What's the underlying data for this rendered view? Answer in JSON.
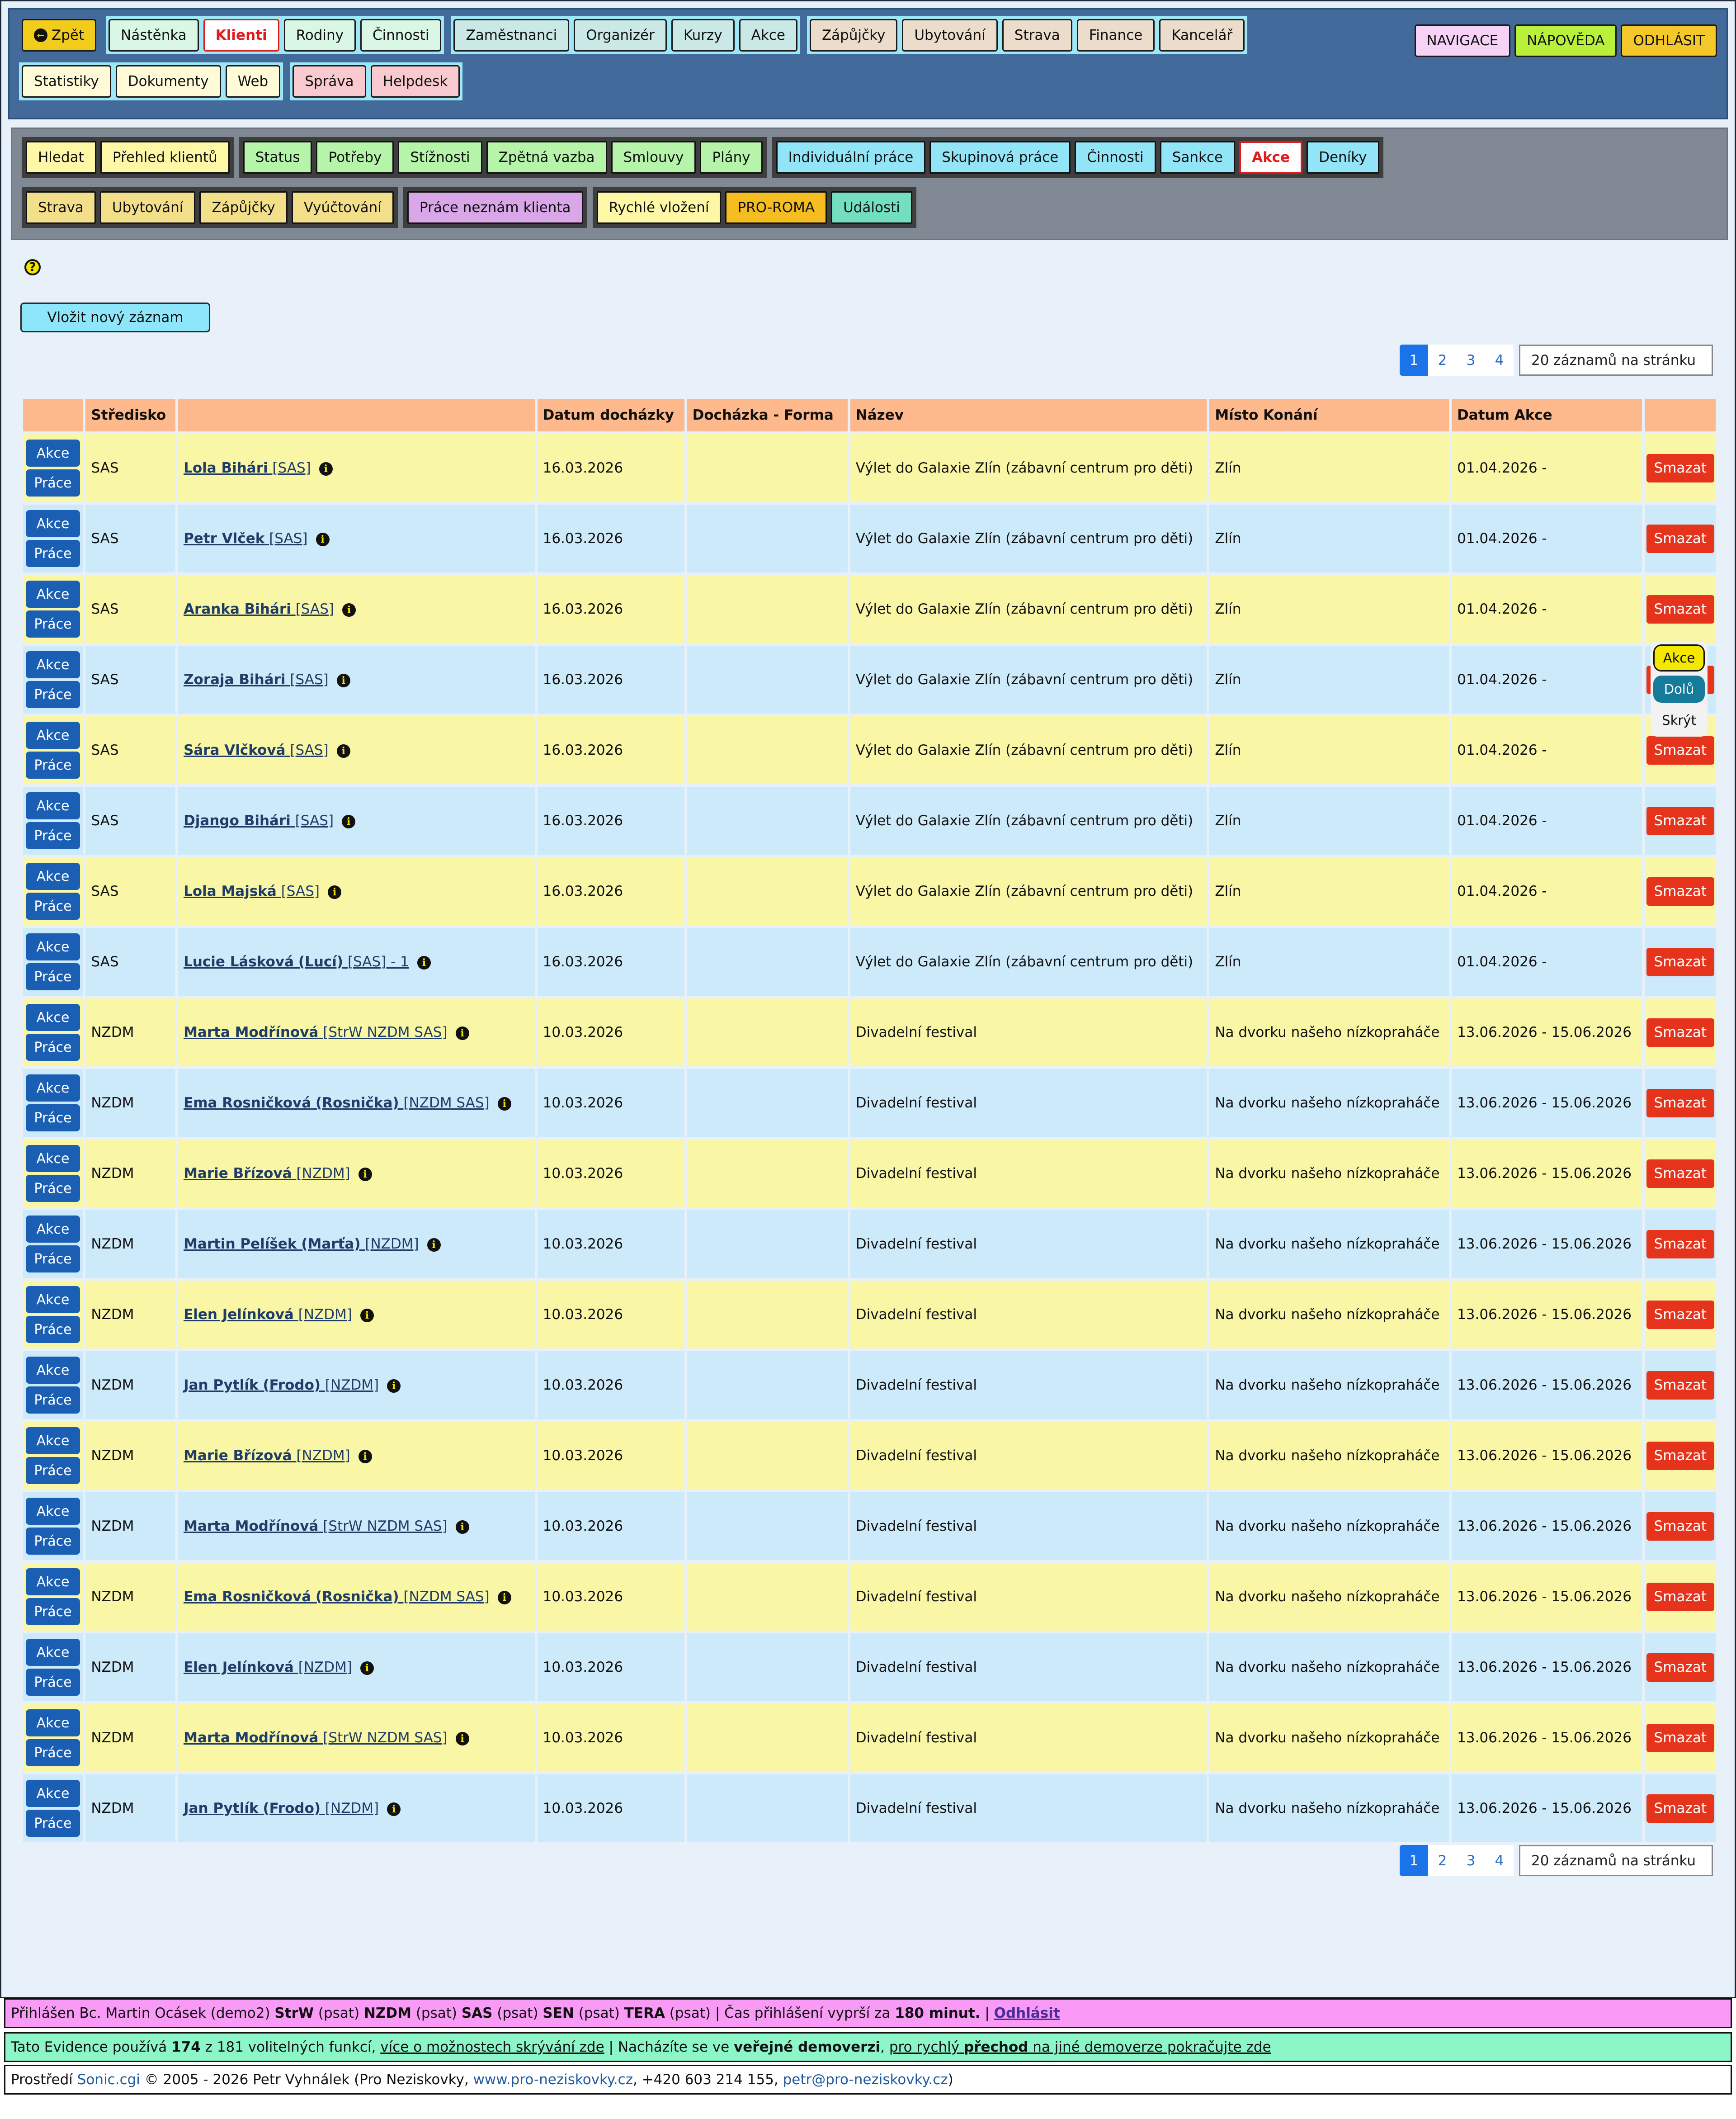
{
  "topnav": {
    "row1": [
      {
        "label": "Zpět",
        "style": "c-yellow",
        "icon": "back-arrow-icon",
        "group": 0
      },
      {
        "label": "Nástěnka",
        "style": "c-mint",
        "group": 1
      },
      {
        "label": "Klienti",
        "style": "c-active",
        "group": 1
      },
      {
        "label": "Rodiny",
        "style": "c-mint",
        "group": 1
      },
      {
        "label": "Činnosti",
        "style": "c-mint",
        "group": 1
      },
      {
        "label": "Zaměstnanci",
        "style": "c-teal",
        "group": 2
      },
      {
        "label": "Organizér",
        "style": "c-teal",
        "group": 2
      },
      {
        "label": "Kurzy",
        "style": "c-teal",
        "group": 2
      },
      {
        "label": "Akce",
        "style": "c-teal",
        "group": 2
      },
      {
        "label": "Zápůjčky",
        "style": "c-beige",
        "group": 3
      },
      {
        "label": "Ubytování",
        "style": "c-beige",
        "group": 3
      },
      {
        "label": "Strava",
        "style": "c-beige",
        "group": 3
      },
      {
        "label": "Finance",
        "style": "c-beige",
        "group": 3
      },
      {
        "label": "Kancelář",
        "style": "c-beige",
        "group": 3
      }
    ],
    "row2": [
      {
        "label": "Statistiky",
        "style": "c-cream",
        "group": 4
      },
      {
        "label": "Dokumenty",
        "style": "c-cream",
        "group": 4
      },
      {
        "label": "Web",
        "style": "c-cream",
        "group": 4
      },
      {
        "label": "Správa",
        "style": "c-pink",
        "group": 5
      },
      {
        "label": "Helpdesk",
        "style": "c-pink",
        "group": 5
      }
    ],
    "right": [
      {
        "label": "NAVIGACE",
        "style": "c-lavender"
      },
      {
        "label": "NÁPOVĚDA",
        "style": "c-lime"
      },
      {
        "label": "ODHLÁSIT",
        "style": "c-gold"
      }
    ]
  },
  "subnav": {
    "row1": [
      [
        {
          "label": "Hledat",
          "style": "s-yel"
        },
        {
          "label": "Přehled klientů",
          "style": "s-yel"
        }
      ],
      [
        {
          "label": "Status",
          "style": "s-green"
        },
        {
          "label": "Potřeby",
          "style": "s-green"
        },
        {
          "label": "Stížnosti",
          "style": "s-green"
        },
        {
          "label": "Zpětná vazba",
          "style": "s-green"
        },
        {
          "label": "Smlouvy",
          "style": "s-green"
        },
        {
          "label": "Plány",
          "style": "s-green"
        }
      ],
      [
        {
          "label": "Individuální práce",
          "style": "s-cyan"
        },
        {
          "label": "Skupinová práce",
          "style": "s-cyan"
        },
        {
          "label": "Činnosti",
          "style": "s-cyan"
        },
        {
          "label": "Sankce",
          "style": "s-cyan"
        },
        {
          "label": "Akce",
          "style": "s-active"
        },
        {
          "label": "Deníky",
          "style": "s-cyan"
        }
      ]
    ],
    "row2": [
      [
        {
          "label": "Strava",
          "style": "s-sand"
        },
        {
          "label": "Ubytování",
          "style": "s-sand"
        },
        {
          "label": "Zápůjčky",
          "style": "s-sand"
        },
        {
          "label": "Vyúčtování",
          "style": "s-sand"
        }
      ],
      [
        {
          "label": "Práce neznám klienta",
          "style": "s-violet"
        }
      ],
      [
        {
          "label": "Rychlé vložení",
          "style": "s-yel"
        },
        {
          "label": "PRO-ROMA",
          "style": "s-orange"
        },
        {
          "label": "Události",
          "style": "s-sea"
        }
      ]
    ]
  },
  "content": {
    "help_glyph": "?",
    "new_record_label": "Vložit nový záznam",
    "pager": {
      "pages": [
        "1",
        "2",
        "3",
        "4"
      ],
      "current": "1",
      "page_size": "20 záznamů na stránku"
    }
  },
  "table": {
    "headers": [
      "",
      "Středisko",
      "",
      "Datum docházky",
      "Docházka - Forma",
      "Název",
      "Místo Konání",
      "Datum Akce",
      ""
    ],
    "row_buttons": {
      "akce": "Akce",
      "prace": "Práce",
      "delete": "Smazat"
    },
    "rows": [
      {
        "stredisko": "SAS",
        "name": "Lola Bihári",
        "nick": "",
        "tags": "[SAS]",
        "date": "16.03.2026",
        "forma": "",
        "nazev": "Výlet do Galaxie Zlín (zábavní centrum pro děti)",
        "misto": "Zlín",
        "datum_akce": "01.04.2026 -"
      },
      {
        "stredisko": "SAS",
        "name": "Petr Vlček",
        "nick": "",
        "tags": "[SAS]",
        "date": "16.03.2026",
        "forma": "",
        "nazev": "Výlet do Galaxie Zlín (zábavní centrum pro děti)",
        "misto": "Zlín",
        "datum_akce": "01.04.2026 -"
      },
      {
        "stredisko": "SAS",
        "name": "Aranka Bihári",
        "nick": "",
        "tags": "[SAS]",
        "date": "16.03.2026",
        "forma": "",
        "nazev": "Výlet do Galaxie Zlín (zábavní centrum pro děti)",
        "misto": "Zlín",
        "datum_akce": "01.04.2026 -"
      },
      {
        "stredisko": "SAS",
        "name": "Zoraja Bihári",
        "nick": "",
        "tags": "[SAS]",
        "date": "16.03.2026",
        "forma": "",
        "nazev": "Výlet do Galaxie Zlín (zábavní centrum pro děti)",
        "misto": "Zlín",
        "datum_akce": "01.04.2026 -"
      },
      {
        "stredisko": "SAS",
        "name": "Sára Vlčková",
        "nick": "",
        "tags": "[SAS]",
        "date": "16.03.2026",
        "forma": "",
        "nazev": "Výlet do Galaxie Zlín (zábavní centrum pro děti)",
        "misto": "Zlín",
        "datum_akce": "01.04.2026 -"
      },
      {
        "stredisko": "SAS",
        "name": "Django Bihári",
        "nick": "",
        "tags": "[SAS]",
        "date": "16.03.2026",
        "forma": "",
        "nazev": "Výlet do Galaxie Zlín (zábavní centrum pro děti)",
        "misto": "Zlín",
        "datum_akce": "01.04.2026 -"
      },
      {
        "stredisko": "SAS",
        "name": "Lola Majská",
        "nick": "",
        "tags": "[SAS]",
        "date": "16.03.2026",
        "forma": "",
        "nazev": "Výlet do Galaxie Zlín (zábavní centrum pro děti)",
        "misto": "Zlín",
        "datum_akce": "01.04.2026 -"
      },
      {
        "stredisko": "SAS",
        "name": "Lucie Lásková",
        "nick": "(Lucí)",
        "tags": "[SAS] - 1",
        "date": "16.03.2026",
        "forma": "",
        "nazev": "Výlet do Galaxie Zlín (zábavní centrum pro děti)",
        "misto": "Zlín",
        "datum_akce": "01.04.2026 -"
      },
      {
        "stredisko": "NZDM",
        "name": "Marta Modřínová",
        "nick": "",
        "tags": "[StrW NZDM SAS]",
        "date": "10.03.2026",
        "forma": "",
        "nazev": "Divadelní festival",
        "misto": "Na dvorku našeho nízkopraháče",
        "datum_akce": "13.06.2026 - 15.06.2026"
      },
      {
        "stredisko": "NZDM",
        "name": "Ema Rosničková",
        "nick": "(Rosnička)",
        "tags": "[NZDM SAS]",
        "date": "10.03.2026",
        "forma": "",
        "nazev": "Divadelní festival",
        "misto": "Na dvorku našeho nízkopraháče",
        "datum_akce": "13.06.2026 - 15.06.2026"
      },
      {
        "stredisko": "NZDM",
        "name": "Marie Břízová",
        "nick": "",
        "tags": "[NZDM]",
        "date": "10.03.2026",
        "forma": "",
        "nazev": "Divadelní festival",
        "misto": "Na dvorku našeho nízkopraháče",
        "datum_akce": "13.06.2026 - 15.06.2026"
      },
      {
        "stredisko": "NZDM",
        "name": "Martin Pelíšek",
        "nick": "(Marťa)",
        "tags": "[NZDM]",
        "date": "10.03.2026",
        "forma": "",
        "nazev": "Divadelní festival",
        "misto": "Na dvorku našeho nízkopraháče",
        "datum_akce": "13.06.2026 - 15.06.2026"
      },
      {
        "stredisko": "NZDM",
        "name": "Elen Jelínková",
        "nick": "",
        "tags": "[NZDM]",
        "date": "10.03.2026",
        "forma": "",
        "nazev": "Divadelní festival",
        "misto": "Na dvorku našeho nízkopraháče",
        "datum_akce": "13.06.2026 - 15.06.2026"
      },
      {
        "stredisko": "NZDM",
        "name": "Jan Pytlík",
        "nick": "(Frodo)",
        "tags": "[NZDM]",
        "date": "10.03.2026",
        "forma": "",
        "nazev": "Divadelní festival",
        "misto": "Na dvorku našeho nízkopraháče",
        "datum_akce": "13.06.2026 - 15.06.2026"
      },
      {
        "stredisko": "NZDM",
        "name": "Marie Břízová",
        "nick": "",
        "tags": "[NZDM]",
        "date": "10.03.2026",
        "forma": "",
        "nazev": "Divadelní festival",
        "misto": "Na dvorku našeho nízkopraháče",
        "datum_akce": "13.06.2026 - 15.06.2026"
      },
      {
        "stredisko": "NZDM",
        "name": "Marta Modřínová",
        "nick": "",
        "tags": "[StrW NZDM SAS]",
        "date": "10.03.2026",
        "forma": "",
        "nazev": "Divadelní festival",
        "misto": "Na dvorku našeho nízkopraháče",
        "datum_akce": "13.06.2026 - 15.06.2026"
      },
      {
        "stredisko": "NZDM",
        "name": "Ema Rosničková",
        "nick": "(Rosnička)",
        "tags": "[NZDM SAS]",
        "date": "10.03.2026",
        "forma": "",
        "nazev": "Divadelní festival",
        "misto": "Na dvorku našeho nízkopraháče",
        "datum_akce": "13.06.2026 - 15.06.2026"
      },
      {
        "stredisko": "NZDM",
        "name": "Elen Jelínková",
        "nick": "",
        "tags": "[NZDM]",
        "date": "10.03.2026",
        "forma": "",
        "nazev": "Divadelní festival",
        "misto": "Na dvorku našeho nízkopraháče",
        "datum_akce": "13.06.2026 - 15.06.2026"
      },
      {
        "stredisko": "NZDM",
        "name": "Marta Modřínová",
        "nick": "",
        "tags": "[StrW NZDM SAS]",
        "date": "10.03.2026",
        "forma": "",
        "nazev": "Divadelní festival",
        "misto": "Na dvorku našeho nízkopraháče",
        "datum_akce": "13.06.2026 - 15.06.2026"
      },
      {
        "stredisko": "NZDM",
        "name": "Jan Pytlík",
        "nick": "(Frodo)",
        "tags": "[NZDM]",
        "date": "10.03.2026",
        "forma": "",
        "nazev": "Divadelní festival",
        "misto": "Na dvorku našeho nízkopraháče",
        "datum_akce": "13.06.2026 - 15.06.2026"
      }
    ]
  },
  "popup": {
    "akce": "Akce",
    "dolu": "Dolů",
    "skryt": "Skrýt"
  },
  "footer": {
    "login": {
      "prefix": "Přihlášen Bc. Martin Ocásek (demo2)",
      "units": [
        {
          "code": "StrW",
          "role": "(psat)"
        },
        {
          "code": "NZDM",
          "role": "(psat)"
        },
        {
          "code": "SAS",
          "role": "(psat)"
        },
        {
          "code": "SEN",
          "role": "(psat)"
        },
        {
          "code": "TERA",
          "role": "(psat)"
        }
      ],
      "sep": "|",
      "expiry_text": "Čas přihlášení vyprší za",
      "expiry_value": "180 minut.",
      "logout": "Odhlásit"
    },
    "features": {
      "t1": "Tato Evidence používá",
      "count": "174",
      "t2": "z 181 volitelných funkcí,",
      "link1": "více o možnostech skrývání zde",
      "sep": "|",
      "t3": "Nacházíte se ve",
      "bold1": "veřejné demoverzi",
      "t4": ",",
      "link2a": "pro rychlý",
      "link2b": "přechod",
      "link2c": "na jiné demoverze pokračujte zde"
    },
    "credits": {
      "t1": "Prostředí",
      "product": "Sonic.cgi",
      "t2": "© 2005 - 2026 Petr Vyhnálek (Pro Neziskovky,",
      "site": "www.pro-neziskovky.cz",
      "t3": ", +420 603 214 155,",
      "email": "petr@pro-neziskovky.cz",
      "t4": ")"
    }
  },
  "colors": {
    "topnav_bg": "#426a9a",
    "subnav_bg": "#808893",
    "row_odd": "#f9f6a6",
    "row_even": "#cdeafb",
    "header_bg": "#fdb88c",
    "delete": "#e5331c",
    "action_button": "#1a5fb4"
  }
}
